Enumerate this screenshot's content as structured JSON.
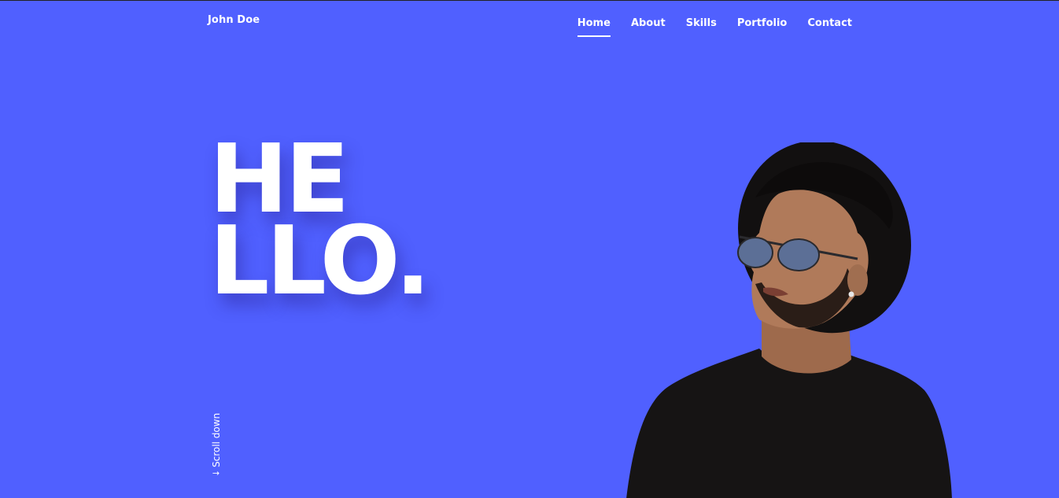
{
  "colors": {
    "background": "#5060ff",
    "text": "#ffffff",
    "shirt": "#161414",
    "hat": "#121010",
    "skin": "#b07a5a",
    "lens": "#5c6f96"
  },
  "navbar": {
    "brand": "John Doe",
    "links": [
      {
        "label": "Home",
        "active": true
      },
      {
        "label": "About",
        "active": false
      },
      {
        "label": "Skills",
        "active": false
      },
      {
        "label": "Portfolio",
        "active": false
      },
      {
        "label": "Contact",
        "active": false
      }
    ]
  },
  "hero": {
    "headline_line1": "HE",
    "headline_line2": "LLO.",
    "scroll_label": "Scroll down",
    "scroll_icon": "arrow-down-icon",
    "portrait_icon": "man-portrait-with-hat-and-sunglasses"
  }
}
